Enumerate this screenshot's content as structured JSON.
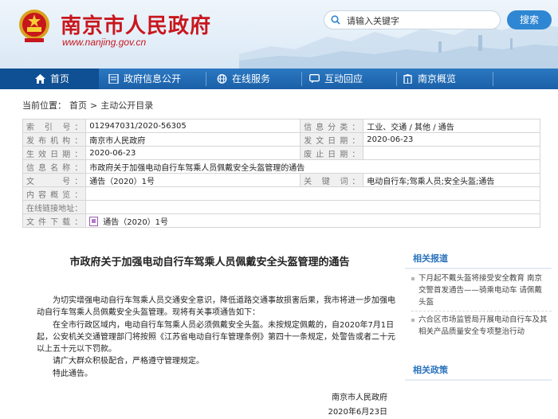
{
  "header": {
    "site_title": "南京市人民政府",
    "site_url": "www.nanjing.gov.cn",
    "search_placeholder": "请输入关键字",
    "search_button": "搜索"
  },
  "nav": [
    {
      "label": "首页",
      "icon": "home-icon"
    },
    {
      "label": "政府信息公开",
      "icon": "document-icon"
    },
    {
      "label": "在线服务",
      "icon": "globe-icon"
    },
    {
      "label": "互动回应",
      "icon": "chat-icon"
    },
    {
      "label": "南京概览",
      "icon": "building-icon"
    }
  ],
  "breadcrumb": {
    "prefix": "当前位置：",
    "items": [
      "首页",
      "主动公开目录"
    ],
    "sep": ">"
  },
  "info": {
    "index_label": "索 引 号：",
    "index_value": "012947031/2020-56305",
    "category_label": "信息分类：",
    "category_value": "工业、交通 / 其他 / 通告",
    "publisher_label": "发布机构：",
    "publisher_value": "南京市人民政府",
    "pubdate_label": "发文日期：",
    "pubdate_value": "2020-06-23",
    "effective_label": "生效日期：",
    "effective_value": "2020-06-23",
    "expiry_label": "废止日期：",
    "expiry_value": "",
    "name_label": "信息名称：",
    "name_value": "市政府关于加强电动自行车驾乘人员佩戴安全头盔管理的通告",
    "docno_label": "文　　号：",
    "docno_value": "通告（2020）1号",
    "keywords_label": "关 键 词：",
    "keywords_value": "电动自行车;驾乘人员;安全头盔;通告",
    "overview_label": "内容概览：",
    "overview_value": "",
    "online_label": "在线链接地址：",
    "online_value": "",
    "download_label": "文件下载：",
    "download_value": "通告（2020）1号"
  },
  "article": {
    "title": "市政府关于加强电动自行车驾乘人员佩戴安全头盔管理的通告",
    "p1": "为切实增强电动自行车驾乘人员交通安全意识，降低道路交通事故损害后果，我市将进一步加强电动自行车驾乘人员佩戴安全头盔管理。现将有关事项通告如下：",
    "p2": "在全市行政区域内，电动自行车驾乘人员必须佩戴安全头盔。未按规定佩戴的，自2020年7月1日起，公安机关交通管理部门将按照《江苏省电动自行车管理条例》第四十一条规定，处警告或者二十元以上五十元以下罚款。",
    "p3": "请广大群众积极配合，严格遵守管理规定。",
    "p4": "特此通告。",
    "signer": "南京市人民政府",
    "date": "2020年6月23日"
  },
  "side": {
    "related_news_title": "相关报道",
    "related_news": [
      "下月起不戴头盔将接受安全教育 南京交警首发通告——骑乘电动车 请佩戴头盔",
      "六合区市场监管局开展电动自行车及其相关产品质量安全专项整治行动"
    ],
    "related_policy_title": "相关政策"
  },
  "colors": {
    "brand_red": "#c8161d",
    "nav_blue": "#1a60a8",
    "accent_blue": "#2a73bd"
  }
}
